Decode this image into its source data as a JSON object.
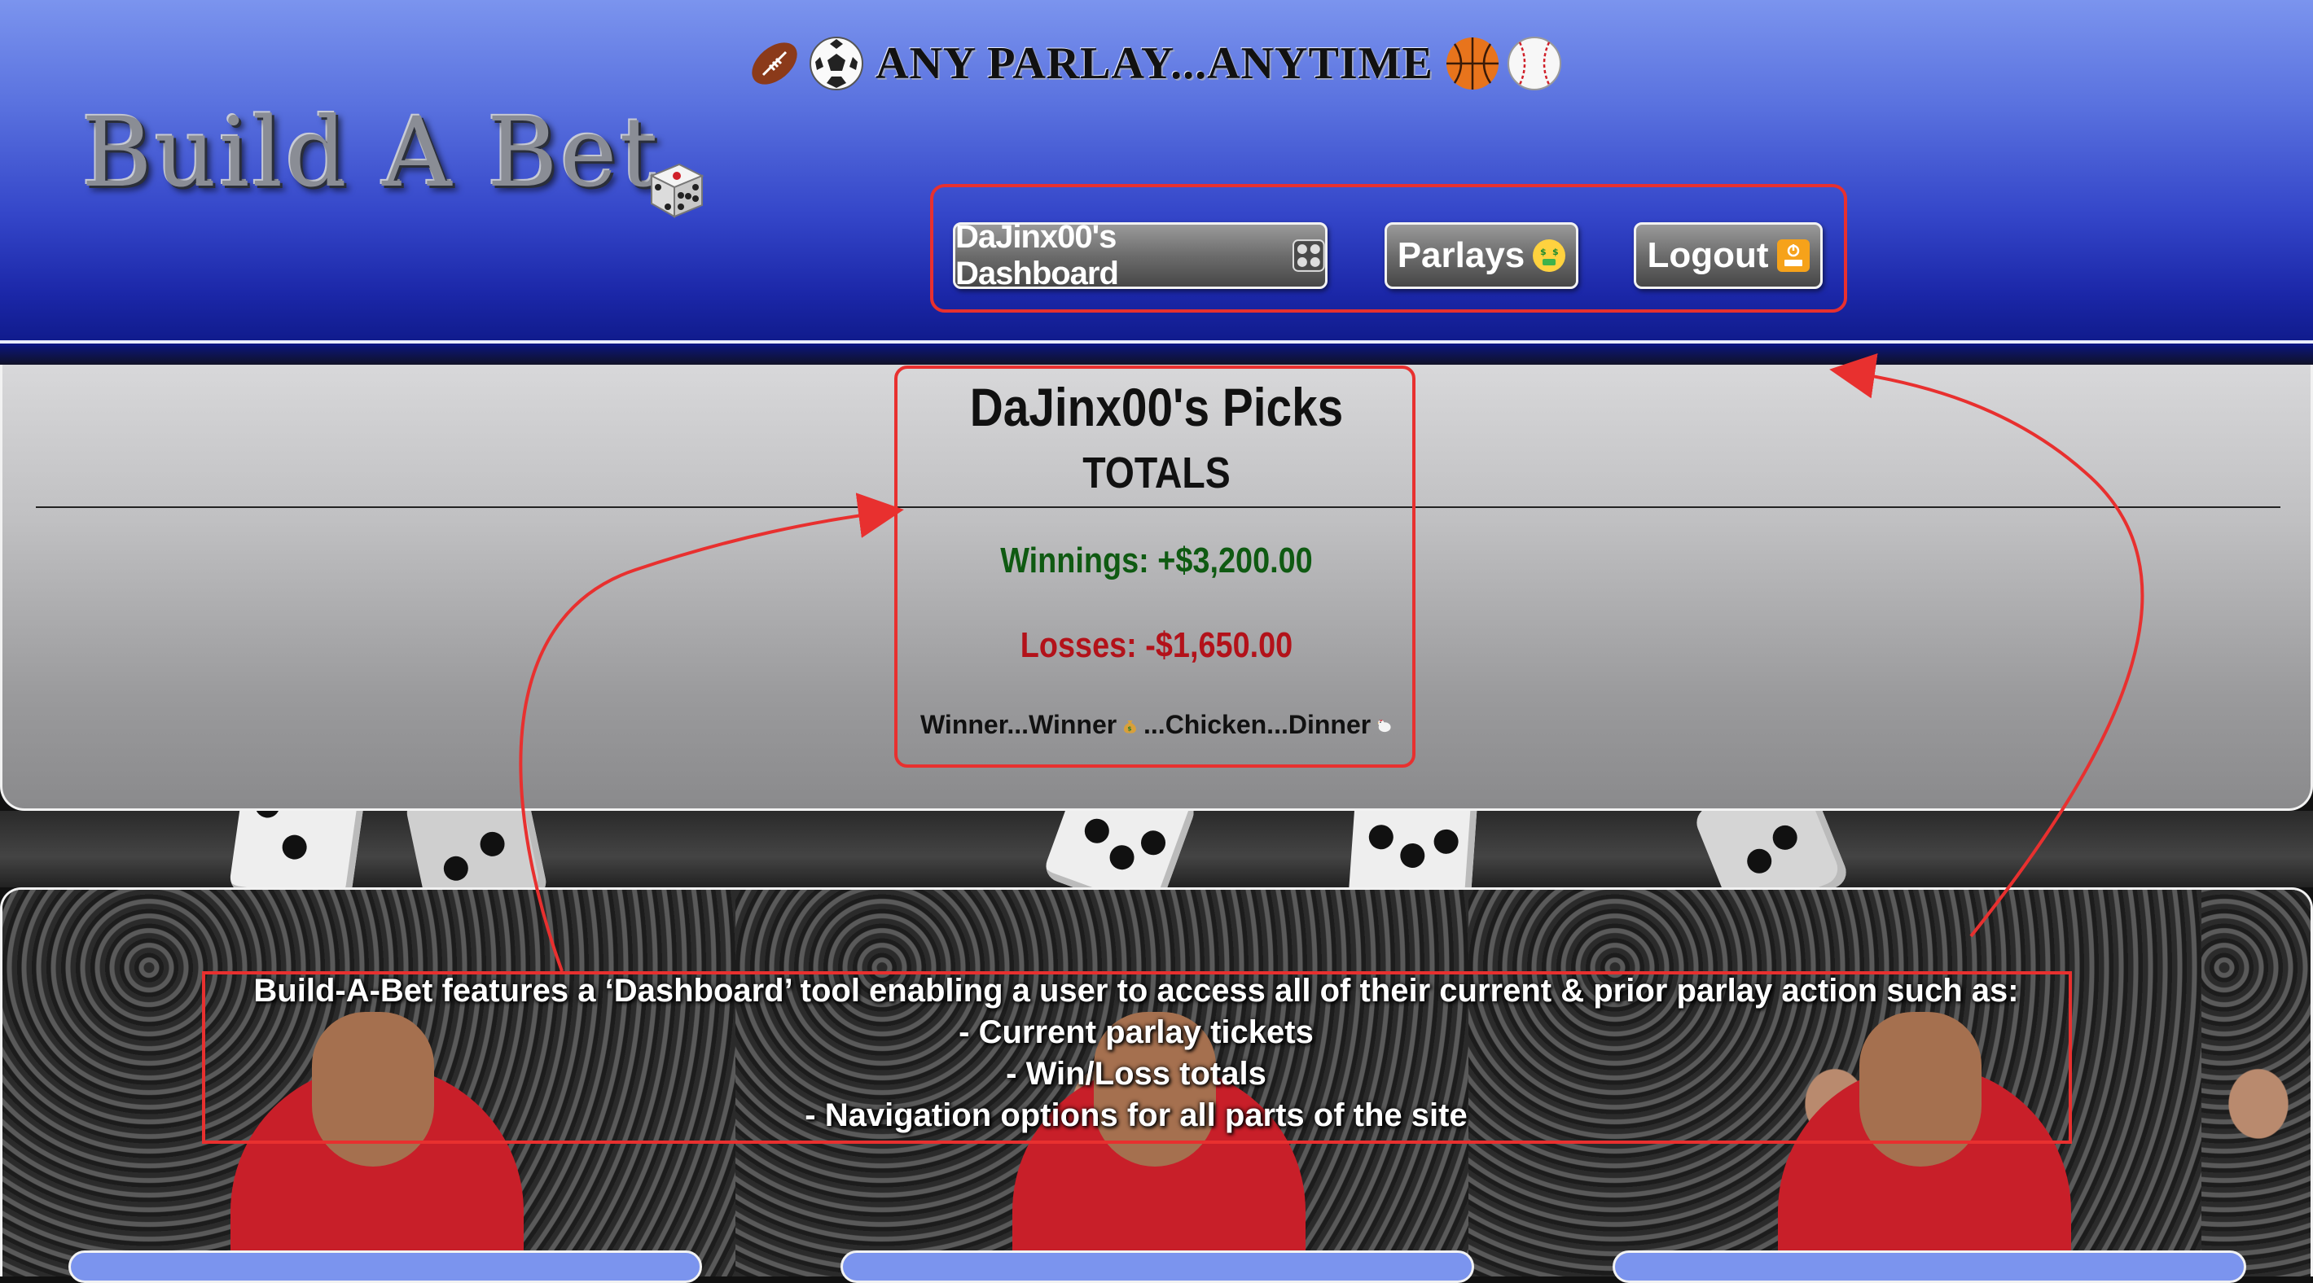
{
  "header": {
    "tagline": "ANY PARLAY...ANYTIME",
    "tagline_icons_left": [
      "football-icon",
      "soccer-ball-icon"
    ],
    "tagline_icons_right": [
      "basketball-icon",
      "baseball-icon"
    ],
    "logo": "Build A Bet",
    "logo_icon": "die-icon"
  },
  "nav": {
    "dashboard_label": "DaJinx00's Dashboard",
    "dashboard_icon": "control-knobs-icon",
    "parlays_label": "Parlays",
    "parlays_icon": "money-mouth-face-icon",
    "logout_label": "Logout",
    "logout_icon": "off-icon"
  },
  "picks": {
    "title": "DaJinx00's Picks",
    "subtitle": "TOTALS",
    "winnings": "Winnings: +$3,200.00",
    "losses": "Losses: -$1,650.00",
    "slogan_part1": "Winner...Winner",
    "slogan_part2": "...Chicken...Dinner",
    "slogan_icons": [
      "money-bag-icon",
      "chicken-icon"
    ]
  },
  "feature": {
    "line1": "Build-A-Bet features a ‘Dashboard’ tool enabling a user to access all of their current & prior parlay action such as:",
    "line2": "- Current parlay tickets",
    "line3": "- Win/Loss totals",
    "line4": "- Navigation options for all parts of the site"
  },
  "colors": {
    "header_top": "#7b94ee",
    "header_bottom": "#0f1a8a",
    "annotation_red": "#e8302f",
    "winnings_green": "#0f5a12",
    "losses_red": "#b3121a"
  }
}
